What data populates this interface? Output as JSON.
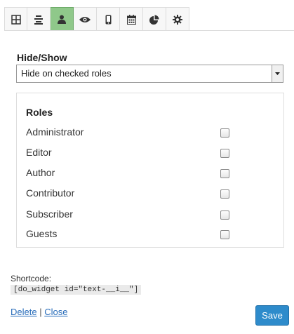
{
  "tabs": [
    {
      "icon": "grid-icon"
    },
    {
      "icon": "align-center-icon"
    },
    {
      "icon": "user-icon",
      "active": true
    },
    {
      "icon": "eye-icon"
    },
    {
      "icon": "mobile-icon"
    },
    {
      "icon": "calendar-icon"
    },
    {
      "icon": "pie-chart-icon"
    },
    {
      "icon": "gear-icon"
    }
  ],
  "visibility": {
    "label": "Hide/Show",
    "selected": "Hide on checked roles"
  },
  "roles": {
    "title": "Roles",
    "items": [
      {
        "label": "Administrator",
        "checked": false
      },
      {
        "label": "Editor",
        "checked": false
      },
      {
        "label": "Author",
        "checked": false
      },
      {
        "label": "Contributor",
        "checked": false
      },
      {
        "label": "Subscriber",
        "checked": false
      },
      {
        "label": "Guests",
        "checked": false
      }
    ]
  },
  "shortcode": {
    "label": "Shortcode:",
    "value": "[do_widget id=\"text-__i__\"]"
  },
  "footer": {
    "delete_label": "Delete",
    "separator": "|",
    "close_label": "Close",
    "save_label": "Save"
  },
  "colors": {
    "active_tab": "#8fc88a",
    "save_button": "#2e8bcb",
    "link": "#2a6ebb"
  }
}
